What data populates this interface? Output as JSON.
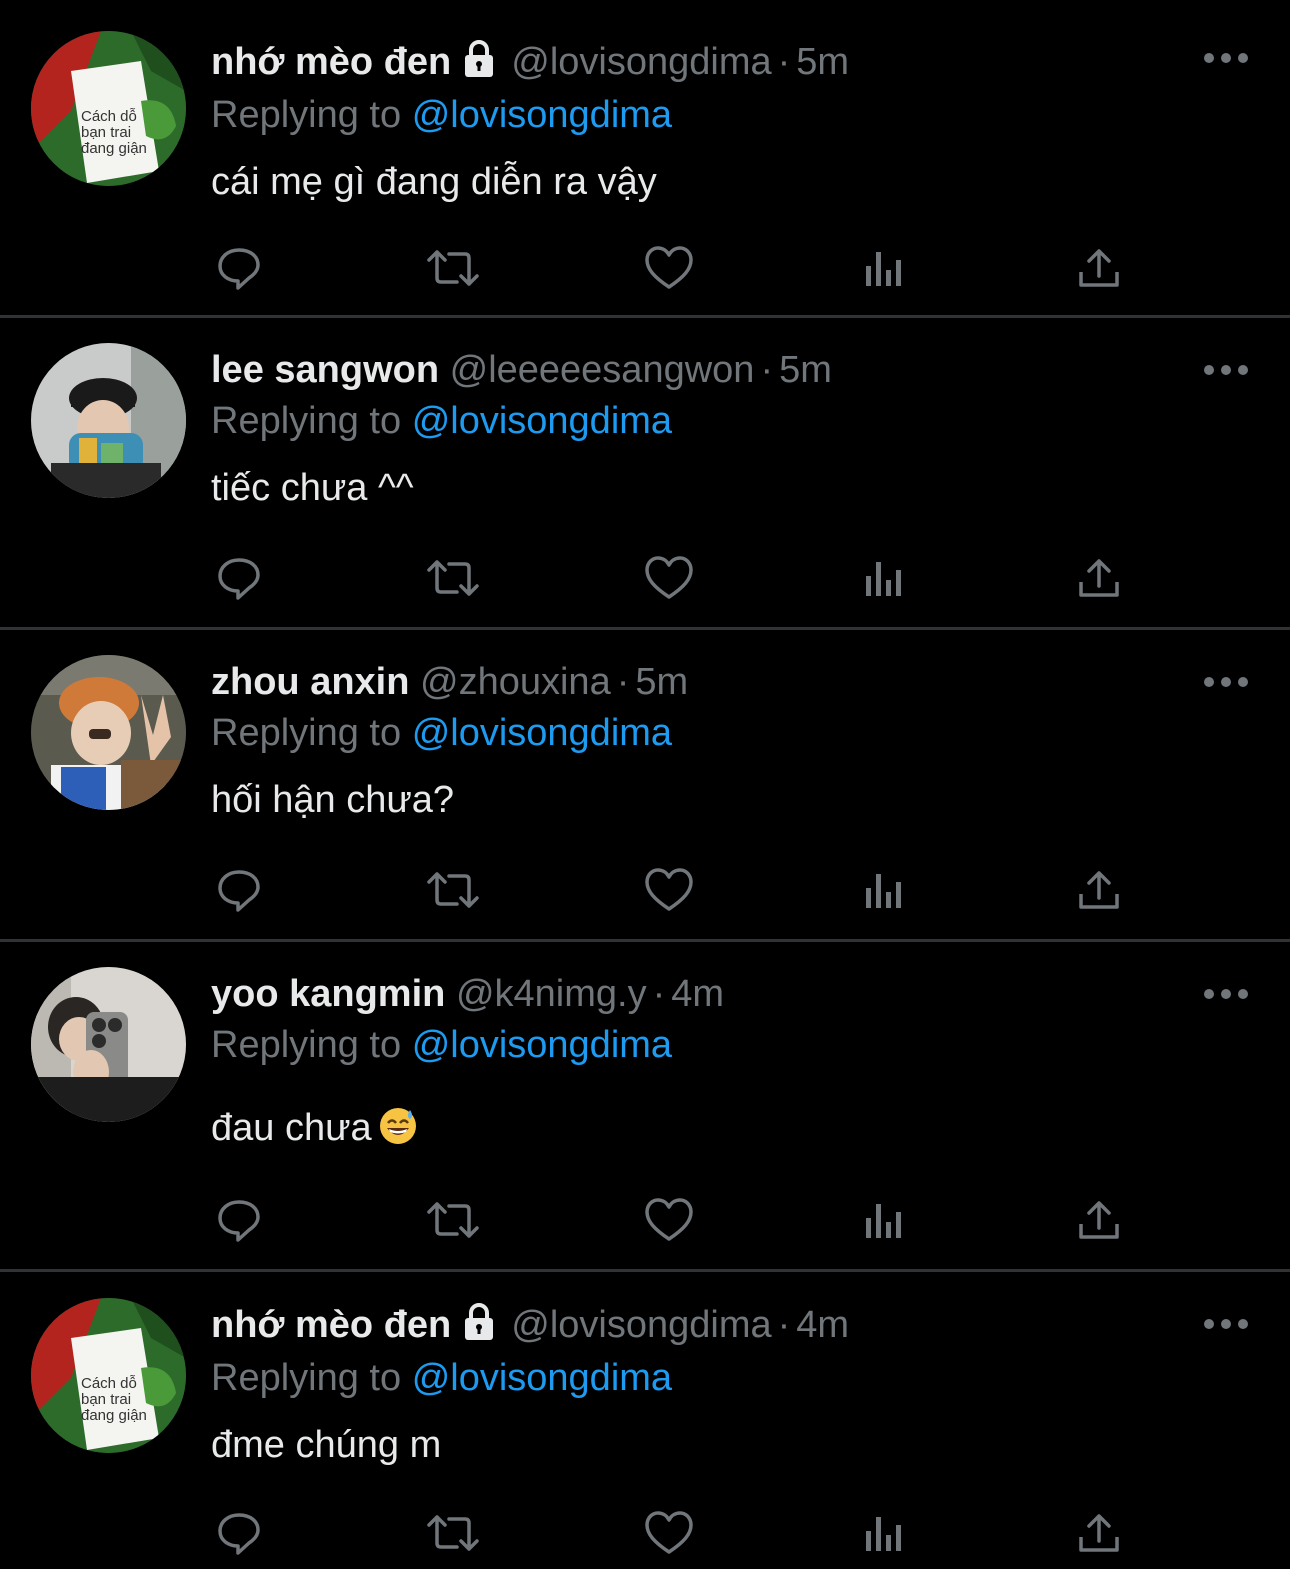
{
  "tweets": [
    {
      "display_name": "nhớ mèo đen",
      "locked": true,
      "handle": "@lovisongdima",
      "separator": "·",
      "time": "5m",
      "replying_prefix": "Replying to",
      "replying_to": "@lovisongdima",
      "text": "cái mẹ gì đang diễn ra vậy",
      "avatar": "book-meme",
      "avatar_text": [
        "Cách dỗ",
        "bạn trai",
        "đang giận"
      ]
    },
    {
      "display_name": "lee sangwon",
      "locked": false,
      "handle": "@leeeeesangwon",
      "separator": "·",
      "time": "5m",
      "replying_prefix": "Replying to",
      "replying_to": "@lovisongdima",
      "text": "tiếc chưa ^^",
      "avatar": "person-cap-scarf"
    },
    {
      "display_name": "zhou anxin",
      "locked": false,
      "handle": "@zhouxina",
      "separator": "·",
      "time": "5m",
      "replying_prefix": "Replying to",
      "replying_to": "@lovisongdima",
      "text": "hối hận chưa?",
      "avatar": "person-orange-hair"
    },
    {
      "display_name": "yoo kangmin",
      "locked": false,
      "handle": "@k4nimg.y",
      "separator": "·",
      "time": "4m",
      "replying_prefix": "Replying to",
      "replying_to": "@lovisongdima",
      "text": "đau chưa",
      "emoji": "grinning-sweat-emoji",
      "avatar": "person-mirror-selfie"
    },
    {
      "display_name": "nhớ mèo đen",
      "locked": true,
      "handle": "@lovisongdima",
      "separator": "·",
      "time": "4m",
      "replying_prefix": "Replying to",
      "replying_to": "@lovisongdima",
      "text": "đme chúng m",
      "avatar": "book-meme",
      "avatar_text": [
        "Cách dỗ",
        "bạn trai",
        "đang giận"
      ]
    }
  ],
  "action_icons": [
    "reply-icon",
    "retweet-icon",
    "like-icon",
    "views-icon",
    "share-icon"
  ],
  "colors": {
    "background": "#000000",
    "primary_text": "#e7e9ea",
    "secondary_text": "#71767b",
    "link": "#1d9bf0",
    "divider": "#2f3336"
  }
}
